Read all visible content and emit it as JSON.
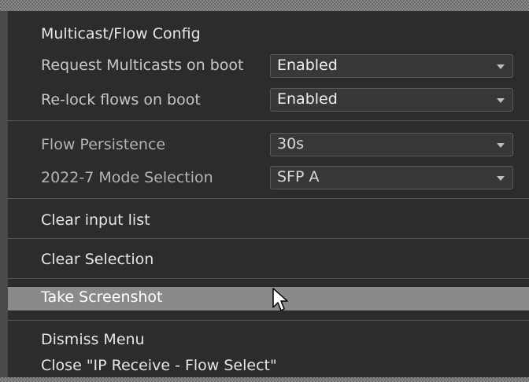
{
  "menu": {
    "section_title": "Multicast/Flow Config",
    "settings": [
      {
        "label": "Request Multicasts on boot",
        "value": "Enabled"
      },
      {
        "label": "Re-lock flows on boot",
        "value": "Enabled"
      },
      {
        "label": "Flow Persistence",
        "value": "30s"
      },
      {
        "label": "2022-7 Mode Selection",
        "value": "SFP A"
      }
    ],
    "actions": {
      "clear_input_list": "Clear input list",
      "clear_selection": "Clear Selection",
      "take_screenshot": "Take Screenshot",
      "dismiss_menu": "Dismiss Menu",
      "close_window": "Close \"IP Receive - Flow Select\""
    },
    "highlighted_item": "take_screenshot"
  },
  "icons": {
    "dropdown": "chevron-down-icon",
    "pointer": "mouse-pointer-icon"
  },
  "colors": {
    "background": "#2c2c2c",
    "highlight": "#8a8a8a",
    "text": "#e6e6e6"
  }
}
